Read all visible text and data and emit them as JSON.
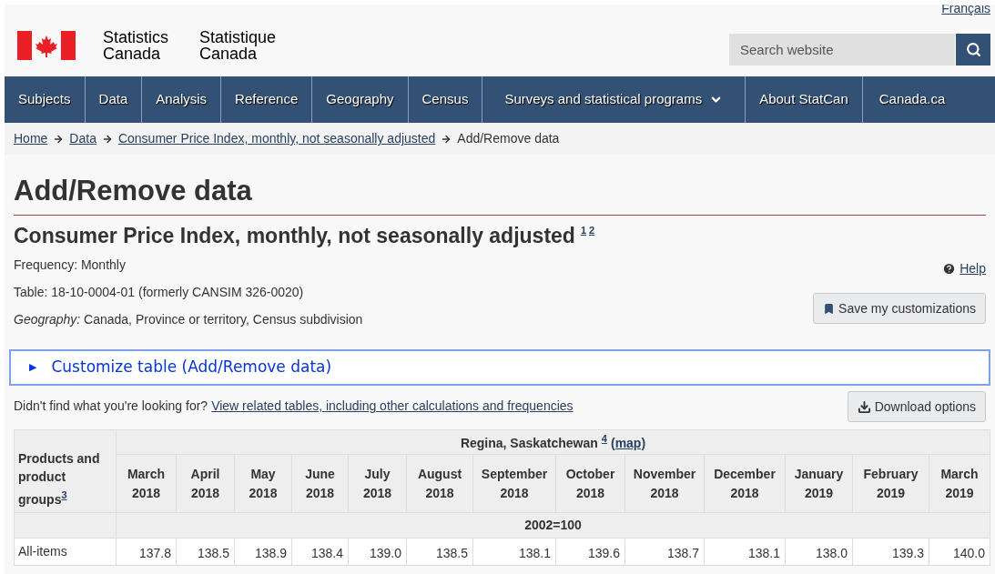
{
  "header": {
    "language_link": "Français",
    "brand_en": [
      "Statistics",
      "Canada"
    ],
    "brand_fr": [
      "Statistique",
      "Canada"
    ],
    "search": {
      "placeholder": "Search website"
    }
  },
  "nav": [
    {
      "label": "Subjects",
      "kind": "link"
    },
    {
      "label": "Data",
      "kind": "link"
    },
    {
      "label": "Analysis",
      "kind": "link"
    },
    {
      "label": "Reference",
      "kind": "link"
    },
    {
      "label": "Geography",
      "kind": "link"
    },
    {
      "label": "Census",
      "kind": "link"
    },
    {
      "label": "Surveys and statistical programs",
      "kind": "dropdown"
    },
    {
      "label": "About StatCan",
      "kind": "link"
    },
    {
      "label": "Canada.ca",
      "kind": "link"
    }
  ],
  "breadcrumb": [
    {
      "label": "Home",
      "kind": "link"
    },
    {
      "label": "Data",
      "kind": "link"
    },
    {
      "label": "Consumer Price Index, monthly, not seasonally adjusted",
      "kind": "link"
    },
    {
      "label": "Add/Remove data",
      "kind": "current"
    }
  ],
  "page_title": "Add/Remove data",
  "table_title": {
    "text": "Consumer Price Index, monthly, not seasonally adjusted",
    "notes": [
      "1",
      "2"
    ]
  },
  "help_link": "Help",
  "meta": {
    "frequency": "Frequency: Monthly",
    "table": "Table: 18-10-0004-01 (formerly CANSIM 326-0020)",
    "geography_label": "Geography:",
    "geography": "Canada, Province or territory, Census subdivision"
  },
  "save_button": "Save my customizations",
  "customize": {
    "icon": "▶",
    "label": "Customize table (Add/Remove data)",
    "expanded": false
  },
  "related": {
    "text": "Didn't find what you're looking for?",
    "link": "View related tables, including other calculations and frequencies"
  },
  "download_button": "Download options",
  "table": {
    "location": "Regina, Saskatchewan",
    "location_note": "4",
    "map_link": "(map)",
    "row_header": "Products and product groups",
    "row_header_note": "3",
    "columns": [
      [
        "March",
        "2018"
      ],
      [
        "April",
        "2018"
      ],
      [
        "May",
        "2018"
      ],
      [
        "June",
        "2018"
      ],
      [
        "July",
        "2018"
      ],
      [
        "August",
        "2018"
      ],
      [
        "September",
        "2018"
      ],
      [
        "October",
        "2018"
      ],
      [
        "November",
        "2018"
      ],
      [
        "December",
        "2018"
      ],
      [
        "January",
        "2019"
      ],
      [
        "February",
        "2019"
      ],
      [
        "March",
        "2019"
      ]
    ],
    "unit": "2002=100",
    "rows": [
      {
        "label": "All-items",
        "values": [
          "137.8",
          "138.5",
          "138.9",
          "138.4",
          "139.0",
          "138.5",
          "138.1",
          "139.6",
          "138.7",
          "138.1",
          "138.0",
          "139.3",
          "140.0"
        ]
      }
    ]
  }
}
